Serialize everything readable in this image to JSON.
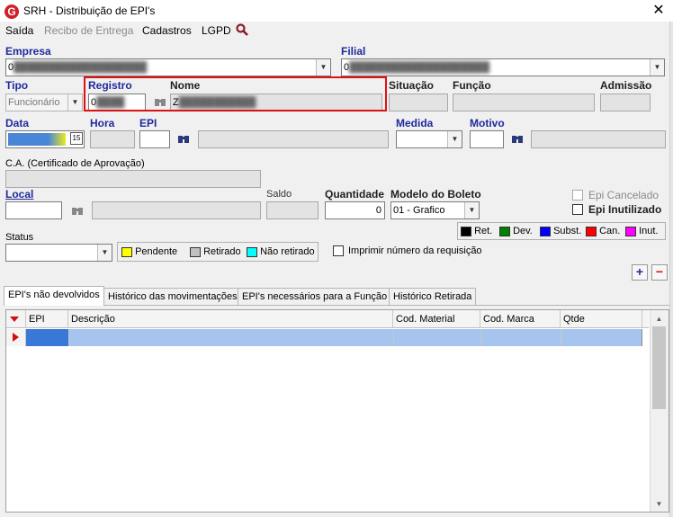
{
  "window": {
    "title": "SRH - Distribuição de EPI's",
    "app_icon_letter": "G",
    "close": "✕"
  },
  "menu": {
    "saida": "Saída",
    "recibo": "Recibo de Entrega",
    "cadastros": "Cadastros",
    "lgpd": "LGPD"
  },
  "form": {
    "empresa_label": "Empresa",
    "empresa_value": "0",
    "filial_label": "Filial",
    "filial_value": "0",
    "tipo_label": "Tipo",
    "tipo_value": "Funcionário",
    "registro_label": "Registro",
    "registro_value": "0",
    "nome_label": "Nome",
    "nome_value": "Z",
    "situacao_label": "Situação",
    "funcao_label": "Função",
    "admissao_label": "Admissão",
    "data_label": "Data",
    "hora_label": "Hora",
    "epi_label": "EPI",
    "medida_label": "Medida",
    "motivo_label": "Motivo",
    "ca_label": "C.A. (Certificado de Aprovação)",
    "local_label": "Local",
    "saldo_label": "Saldo",
    "quantidade_label": "Quantidade",
    "quantidade_value": "0",
    "modelo_label": "Modelo do Boleto",
    "modelo_value": "01 - Grafico",
    "epi_cancelado": "Epi Cancelado",
    "epi_inutilizado": "Epi Inutilizado",
    "status_label": "Status",
    "imprimir_label": "Imprimir número da requisição"
  },
  "status_legend": [
    {
      "label": "Pendente",
      "color": "#ffff00"
    },
    {
      "label": "Retirado",
      "color": "#c0c0c0"
    },
    {
      "label": "Não retirado",
      "color": "#00ffff"
    }
  ],
  "type_legend": [
    {
      "label": "Ret.",
      "color": "#000000"
    },
    {
      "label": "Dev.",
      "color": "#008000"
    },
    {
      "label": "Subst.",
      "color": "#0000ff"
    },
    {
      "label": "Can.",
      "color": "#ff0000"
    },
    {
      "label": "Inut.",
      "color": "#ff00ff"
    }
  ],
  "tabs": [
    {
      "label": "EPI's não devolvidos"
    },
    {
      "label": "Histórico das movimentações"
    },
    {
      "label": "EPI's necessários para a Função"
    },
    {
      "label": "Histórico Retirada"
    }
  ],
  "grid": {
    "columns": [
      "EPI",
      "Descrição",
      "Cod. Material",
      "Cod. Marca",
      "Qtde"
    ]
  },
  "buttons": {
    "add": "+",
    "remove": "−"
  }
}
